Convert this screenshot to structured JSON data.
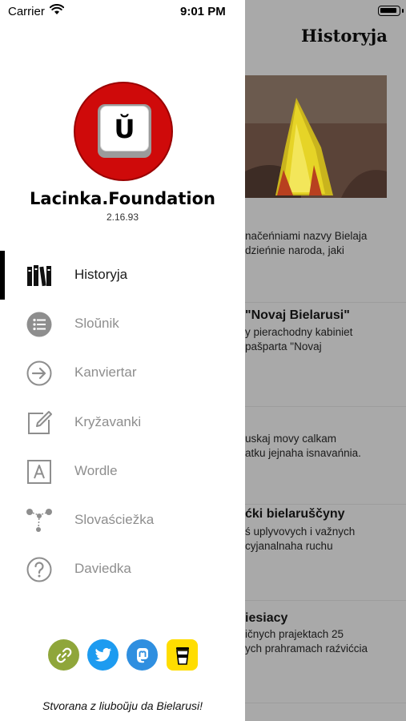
{
  "status_bar": {
    "carrier": "Carrier",
    "time": "9:01 PM"
  },
  "background": {
    "title": "Historyja",
    "items": [
      {
        "title": "",
        "lines": [
          "načeńniami nazvy Bielaja",
          "dzieńnie naroda, jaki"
        ]
      },
      {
        "title": "\"Novaj Bielarusi\"",
        "lines": [
          "y pierachodny kabiniet",
          "pašparta \"Novaj"
        ]
      },
      {
        "title": "",
        "lines": [
          "uskaj movy calkam",
          "atku jejnaha isnavańnia."
        ]
      },
      {
        "title": "ćki bielaruščyny",
        "lines": [
          "ś uplyvovych i važnych",
          "cyjanalnaha ruchu"
        ]
      },
      {
        "title": "iesiacy",
        "lines": [
          "ičnych prajektach 25",
          "ych prahramach raźvićcia"
        ]
      }
    ]
  },
  "drawer": {
    "logo_letter": "Ŭ",
    "app_name": "Lacinka.Foundation",
    "version": "2.16.93",
    "menu": [
      {
        "label": "Historyja",
        "icon": "books-icon",
        "active": true
      },
      {
        "label": "Slоŭnik",
        "icon": "list-icon",
        "active": false
      },
      {
        "label": "Kanviertar",
        "icon": "arrow-circle-icon",
        "active": false
      },
      {
        "label": "Kryžavanki",
        "icon": "edit-icon",
        "active": false
      },
      {
        "label": "Wordle",
        "icon": "letter-a-icon",
        "active": false
      },
      {
        "label": "Slovaściežka",
        "icon": "path-icon",
        "active": false
      },
      {
        "label": "Daviedka",
        "icon": "help-icon",
        "active": false
      }
    ],
    "socials": [
      {
        "name": "link",
        "icon": "link-icon",
        "color": "#8fa63a"
      },
      {
        "name": "twitter",
        "icon": "twitter-icon",
        "color": "#1d9bf0"
      },
      {
        "name": "mastodon",
        "icon": "mastodon-icon",
        "color": "#2f8fe0"
      },
      {
        "name": "buymeacoffee",
        "icon": "coffee-cup-icon",
        "color": "#ffdd00"
      }
    ],
    "tagline": "Stvorana z liubоŭju da Bielarusi!"
  },
  "colors": {
    "logo_red": "#cf0a0a",
    "overlay_gray": "#a9a9a9",
    "inactive_text": "#8e8e8e"
  }
}
